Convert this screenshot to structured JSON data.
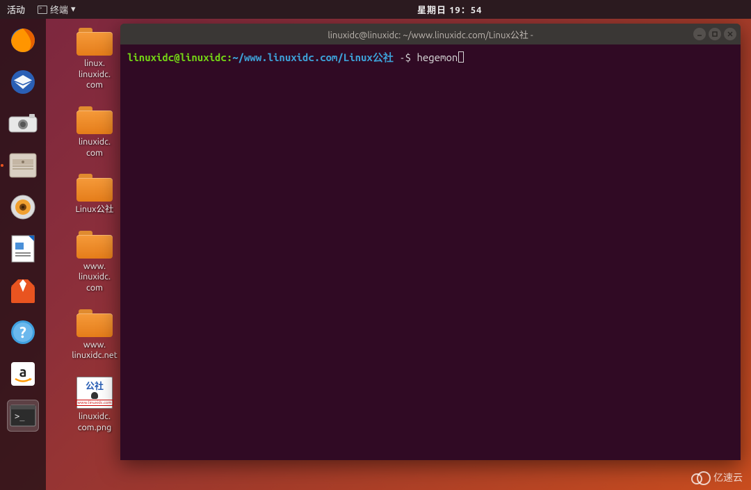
{
  "top_panel": {
    "activities": "活动",
    "app_menu": "终端",
    "clock": "星期日 19：54"
  },
  "dock": {
    "items": [
      {
        "name": "firefox-icon"
      },
      {
        "name": "thunderbird-icon"
      },
      {
        "name": "shotwell-icon"
      },
      {
        "name": "files-icon"
      },
      {
        "name": "rhythmbox-icon"
      },
      {
        "name": "libreoffice-writer-icon"
      },
      {
        "name": "software-center-icon"
      },
      {
        "name": "help-icon"
      },
      {
        "name": "amazon-icon"
      },
      {
        "name": "terminal-icon"
      }
    ]
  },
  "desktop": {
    "icons": [
      {
        "type": "folder",
        "label": "linux.\nlinuxidc.\ncom"
      },
      {
        "type": "folder",
        "label": "linuxidc.\ncom"
      },
      {
        "type": "folder",
        "label": "Linux公社"
      },
      {
        "type": "folder",
        "label": "www.\nlinuxidc.\ncom"
      },
      {
        "type": "folder",
        "label": "www.\nlinuxidc.net"
      },
      {
        "type": "image",
        "label": "linuxidc.\ncom.png",
        "thumb_text": "公社",
        "thumb_footer": "www.linuxidc.com"
      }
    ]
  },
  "terminal": {
    "title": "linuxidc@linuxidc: ~/www.linuxidc.com/Linux公社 -",
    "prompt": {
      "user_host": "linuxidc@linuxidc",
      "colon": ":",
      "path": "~/www.linuxidc.com/Linux公社",
      "suffix": " -$ ",
      "command": "hegemon"
    }
  },
  "watermark": "亿速云"
}
